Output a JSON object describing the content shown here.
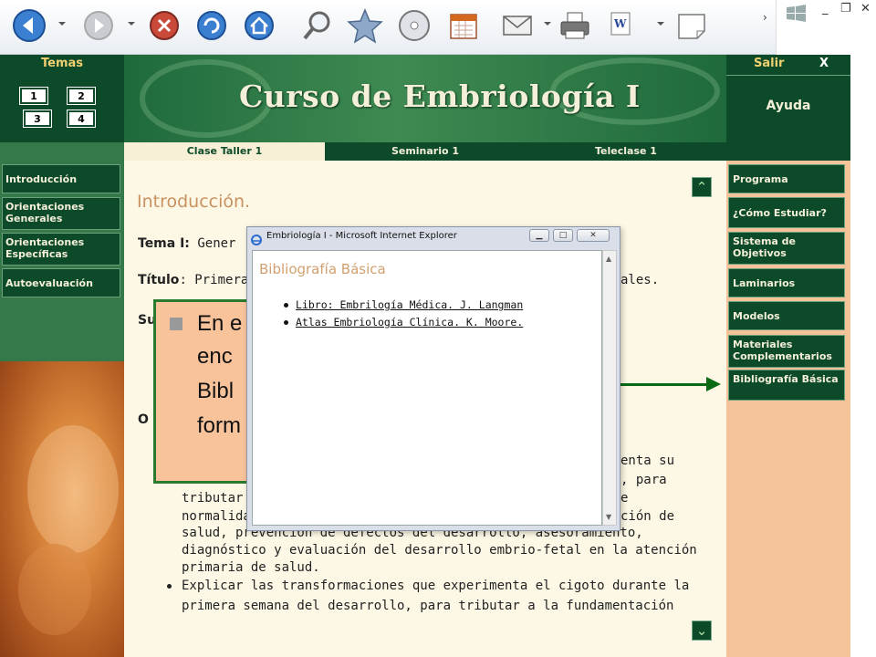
{
  "header": {
    "temas_label": "Temas",
    "tema_buttons": [
      "1",
      "2",
      "3",
      "4"
    ],
    "course_title": "Curso de Embriología I",
    "exit_label": "Salir",
    "exit_x": "X",
    "help_label": "Ayuda"
  },
  "tabs": [
    "Clase Taller 1",
    "Seminario 1",
    "Teleclase 1"
  ],
  "left_nav": [
    "Introducción",
    "Orientaciones Generales",
    "Orientaciones Específicas",
    "Autoevaluación"
  ],
  "right_nav": [
    "Programa",
    "¿Cómo Estudiar?",
    "Sistema de Objetivos",
    "Laminarios",
    "Modelos",
    "Materiales Complementarios",
    "Bibliografía Básica"
  ],
  "main": {
    "section_title": "Introducción.",
    "tema_label": "Tema I:",
    "tema_value": "Gener",
    "titulo_label": "Título",
    "titulo_value": ": Primera",
    "titulo_tail": "ales.",
    "sumario_label": "Su",
    "objetivos_label": "O",
    "body_lines_right": [
      "enta su",
      ", para",
      "e",
      "ción de"
    ],
    "body_lines": [
      "tributar a",
      "normalida",
      "salud, prevención de defectos del desarrollo, asesoramiento,",
      "diagnóstico y evaluación del desarrollo embrio-fetal en la atención",
      "primaria de salud.",
      "Explicar las transformaciones que experimenta el cigoto durante la",
      "primera semana del desarrollo, para tributar a la fundamentación"
    ]
  },
  "callout": {
    "lines": [
      "En e",
      "enc",
      "Bibl",
      "form"
    ]
  },
  "popup": {
    "window_title": "Embriología I - Microsoft Internet Explorer",
    "heading": "Bibliografía Básica",
    "links": [
      "Libro: Embrilogía Médica. J. Langman",
      "Atlas Embriología Clínica. K. Moore."
    ]
  },
  "colors": {
    "dark_green": "#0d4a2a",
    "cream": "#fdf8e6",
    "peach": "#f5c39a",
    "arrow_green": "#0a6a14"
  }
}
